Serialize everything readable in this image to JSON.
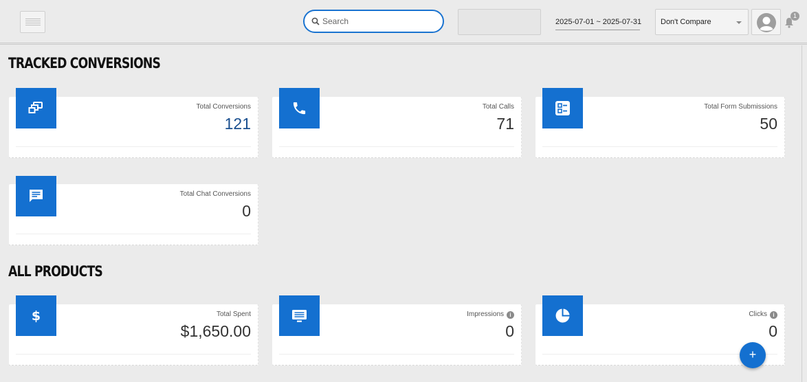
{
  "header": {
    "search_placeholder": "Search",
    "date_range": "2025-07-01 ~ 2025-07-31",
    "compare_selected": "Don't Compare",
    "notification_count": "1"
  },
  "sections": {
    "tracked_title": "TRACKED CONVERSIONS",
    "products_title": "ALL PRODUCTS"
  },
  "tracked": [
    {
      "label": "Total Conversions",
      "value": "121",
      "icon": "conversions-icon"
    },
    {
      "label": "Total Calls",
      "value": "71",
      "icon": "phone-icon"
    },
    {
      "label": "Total Form Submissions",
      "value": "50",
      "icon": "form-icon"
    },
    {
      "label": "Total Chat Conversions",
      "value": "0",
      "icon": "chat-icon"
    }
  ],
  "products": [
    {
      "label": "Total Spent",
      "value": "$1,650.00",
      "icon": "dollar-icon"
    },
    {
      "label": "Impressions",
      "value": "0",
      "icon": "impressions-icon"
    },
    {
      "label": "Clicks",
      "value": "0",
      "icon": "pie-chart-icon"
    }
  ],
  "fab_label": "+",
  "info_glyph": "i",
  "colors": {
    "accent": "#1470d0",
    "background": "#ebebeb"
  }
}
